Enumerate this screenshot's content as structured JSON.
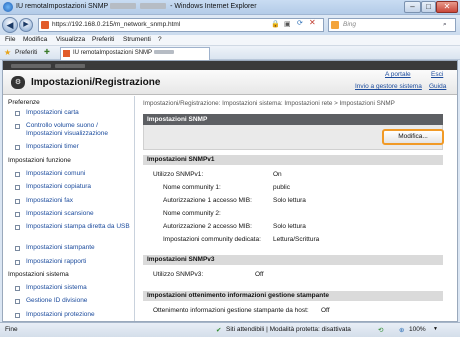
{
  "window": {
    "title_prefix": "IU remotaImpostazioni SNMP",
    "title_suffix": "- Windows Internet Explorer",
    "min": "–",
    "max": "□",
    "close": "✕"
  },
  "address": {
    "url": "https://192.168.0.215/m_network_snmp.html",
    "search_placeholder": "Bing"
  },
  "menu": {
    "file": "File",
    "edit": "Modifica",
    "view": "Visualizza",
    "favorites": "Preferiti",
    "tools": "Strumenti",
    "help": "?"
  },
  "favbar": {
    "favorites": "Preferiti",
    "tab_title": "IU remotaImpostazioni SNMP"
  },
  "header": {
    "title": "Impostazioni/Registrazione",
    "portal": "A portale",
    "logout": "Esci",
    "send_admin": "Invio a gestore sistema",
    "guide": "Guida"
  },
  "sidebar": {
    "pref_heading": "Preferenze",
    "pref_items": [
      "Impostazioni carta",
      "Controllo volume suono / Impostazioni visualizzazione",
      "Impostazioni timer"
    ],
    "func_heading": "Impostazioni funzione",
    "func_items": [
      "Impostazioni comuni",
      "Impostazioni copiatura",
      "Impostazioni fax",
      "Impostazioni scansione",
      "Impostazioni stampa diretta da USB",
      "Impostazioni stampante",
      "Impostazioni rapporti"
    ],
    "sys_heading": "Impostazioni sistema",
    "sys_items": [
      "Impostazioni sistema",
      "Gestione ID divisione",
      "Impostazioni protezione"
    ]
  },
  "main": {
    "breadcrumb": "Impostazioni/Registrazione: Impostazioni sistema: Impostazioni rete > Impostazioni SNMP",
    "page_heading": "Impostazioni SNMP",
    "edit_button": "Modifica...",
    "snmpv1": {
      "heading": "Impostazioni SNMPv1",
      "use_label": "Utilizzo SNMPv1:",
      "use_value": "On",
      "name1_label": "Nome community 1:",
      "name1_value": "public",
      "auth1_label": "Autorizzazione 1 accesso MIB:",
      "auth1_value": "Solo lettura",
      "name2_label": "Nome community 2:",
      "auth2_label": "Autorizzazione 2 accesso MIB:",
      "auth2_value": "Solo lettura",
      "dedicated_label": "Impostazioni community dedicata:",
      "dedicated_value": "Lettura/Scrittura"
    },
    "snmpv3": {
      "heading": "Impostazioni SNMPv3",
      "use_label": "Utilizzo SNMPv3:",
      "use_value": "Off"
    },
    "printer_info": {
      "heading": "Impostazioni ottenimento informazioni gestione stampante",
      "label": "Ottenimento informazioni gestione stampante da host:",
      "value": "Off"
    }
  },
  "status": {
    "left": "Fine",
    "zone": "Siti attendibili | Modalità protetta: disattivata",
    "zoom": "100%"
  }
}
